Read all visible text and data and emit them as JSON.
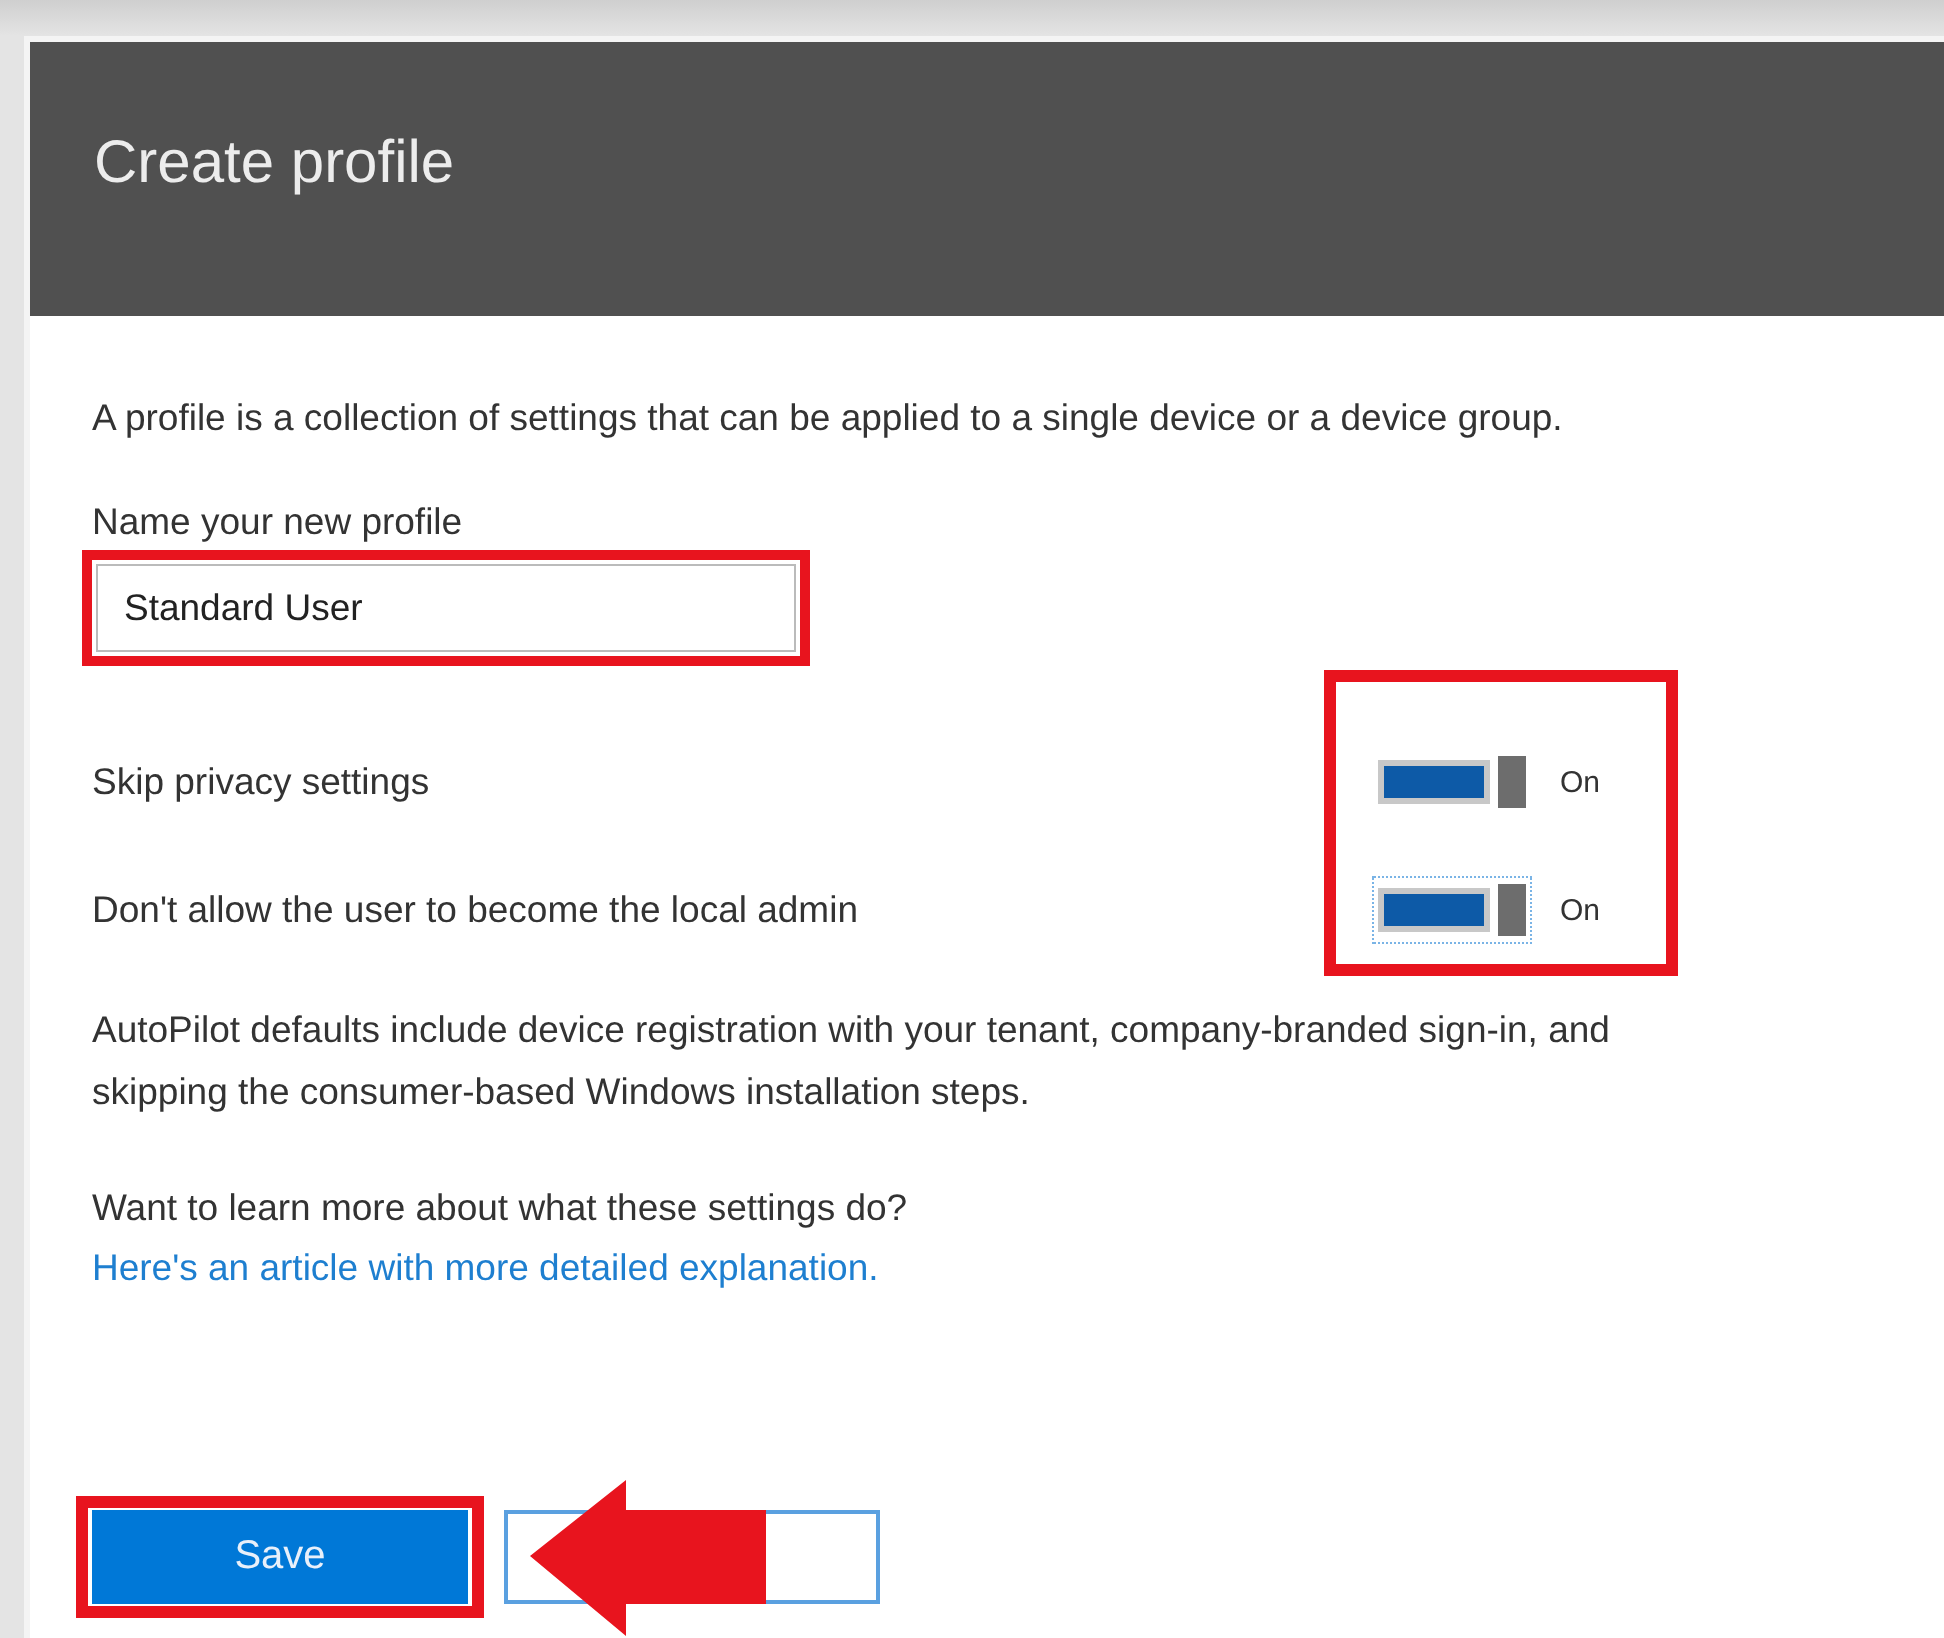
{
  "dialog": {
    "title": "Create profile"
  },
  "description": "A profile is a collection of settings that can be applied to a single device or a device group.",
  "name_field": {
    "label": "Name your new profile",
    "value": "Standard User"
  },
  "settings": [
    {
      "label": "Skip privacy settings",
      "on": true,
      "state_text": "On",
      "focused": false
    },
    {
      "label": "Don't allow the user to become the local admin",
      "on": true,
      "state_text": "On",
      "focused": true
    }
  ],
  "defaults_note": "AutoPilot defaults include device registration with your tenant, company-branded sign-in, and skipping the consumer-based Windows installation steps.",
  "learn_more": {
    "question": "Want to learn more about what these settings do?",
    "link": "Here's an article with more detailed explanation."
  },
  "buttons": [
    {
      "label": "Save",
      "kind": "primary"
    },
    {
      "kind": "secondary"
    }
  ]
}
